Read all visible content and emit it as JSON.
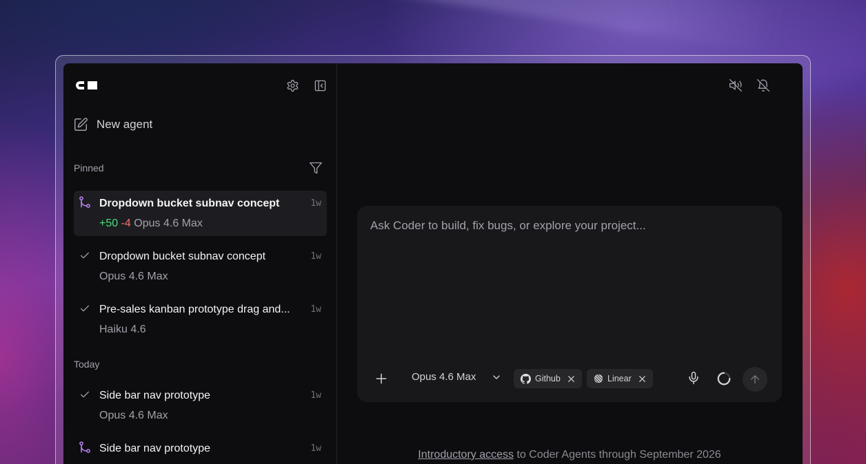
{
  "sidebar": {
    "new_agent_label": "New agent",
    "pinned_label": "Pinned",
    "today_label": "Today",
    "pinned_items": [
      {
        "title": "Dropdown bucket subnav concept",
        "time": "1w",
        "additions": "+50",
        "deletions": "-4",
        "model": "Opus 4.6 Max",
        "status": "branch-icon",
        "active": true
      },
      {
        "title": "Dropdown bucket subnav concept",
        "time": "1w",
        "model": "Opus 4.6 Max",
        "status": "check-icon"
      },
      {
        "title": "Pre-sales kanban prototype drag and...",
        "time": "1w",
        "model": "Haiku 4.6",
        "status": "check-icon"
      }
    ],
    "today_items": [
      {
        "title": "Side bar nav prototype",
        "time": "1w",
        "model": "Opus 4.6 Max",
        "status": "check-icon"
      },
      {
        "title": "Side bar nav prototype",
        "time": "1w",
        "model": "",
        "status": "branch-icon"
      }
    ]
  },
  "composer": {
    "placeholder": "Ask Coder to build, fix bugs, or explore your project...",
    "model": "Opus 4.6 Max",
    "chips": [
      {
        "label": "Github",
        "icon": "github-icon"
      },
      {
        "label": "Linear",
        "icon": "linear-icon"
      }
    ]
  },
  "footer": {
    "link_text": "Introductory access",
    "rest_text": " to Coder Agents through September 2026"
  },
  "colors": {
    "accent_purple": "#c084fc",
    "additions": "#4ade80",
    "deletions": "#f87171",
    "surface": "#0d0d10"
  }
}
